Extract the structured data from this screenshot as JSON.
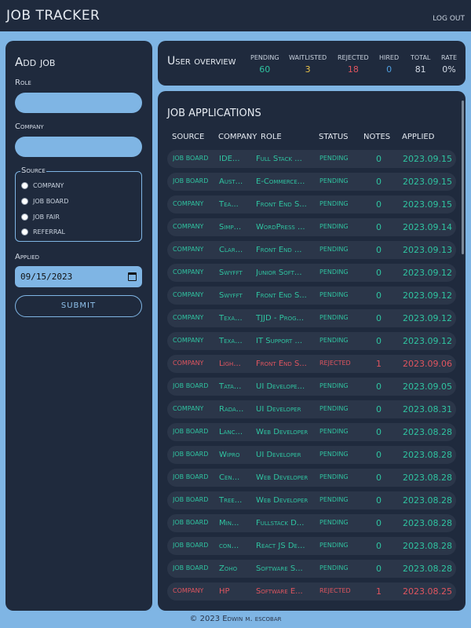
{
  "app": {
    "title": "JOB TRACKER",
    "logout_label": "LOG OUT"
  },
  "add_job": {
    "title": "Add job",
    "role_label": "Role",
    "role_value": "",
    "company_label": "Company",
    "company_value": "",
    "source_legend": "Source",
    "source_options": [
      "company",
      "job board",
      "job fair",
      "referral"
    ],
    "applied_label": "Applied",
    "applied_value": "09/15/2023",
    "submit_label": "SUBMIT"
  },
  "overview": {
    "title": "User overview",
    "stats": [
      {
        "label": "Pending",
        "value": "60",
        "color": "#2fc3a0"
      },
      {
        "label": "Waitlisted",
        "value": "3",
        "color": "#e7c24a"
      },
      {
        "label": "Rejected",
        "value": "18",
        "color": "#e0555f"
      },
      {
        "label": "Hired",
        "value": "0",
        "color": "#4f9fe0"
      },
      {
        "label": "Total",
        "value": "81",
        "color": "#d4dbe6"
      },
      {
        "label": "Rate",
        "value": "0%",
        "color": "#d4dbe6"
      }
    ]
  },
  "applications": {
    "title": "Job applications",
    "columns": [
      "Source",
      "Company",
      "Role",
      "Status",
      "Notes",
      "Applied"
    ],
    "rows": [
      {
        "source": "job board",
        "company": "IDE...",
        "role": "Full Stack ...",
        "status": "pending",
        "notes": "0",
        "applied": "2023.09.15"
      },
      {
        "source": "job board",
        "company": "Aust...",
        "role": "E-Commerce...",
        "status": "pending",
        "notes": "0",
        "applied": "2023.09.15"
      },
      {
        "source": "company",
        "company": "Tea...",
        "role": "Front End S...",
        "status": "pending",
        "notes": "0",
        "applied": "2023.09.15"
      },
      {
        "source": "company",
        "company": "Simp...",
        "role": "WordPress ...",
        "status": "pending",
        "notes": "0",
        "applied": "2023.09.14"
      },
      {
        "source": "company",
        "company": "Clar...",
        "role": "Front End ...",
        "status": "pending",
        "notes": "0",
        "applied": "2023.09.13"
      },
      {
        "source": "company",
        "company": "Swyfft",
        "role": "Junior Soft...",
        "status": "pending",
        "notes": "0",
        "applied": "2023.09.12"
      },
      {
        "source": "company",
        "company": "Swyfft",
        "role": "Front End S...",
        "status": "pending",
        "notes": "0",
        "applied": "2023.09.12"
      },
      {
        "source": "company",
        "company": "Texa...",
        "role": "TJJD - Prog...",
        "status": "pending",
        "notes": "0",
        "applied": "2023.09.12"
      },
      {
        "source": "company",
        "company": "Texa...",
        "role": "IT Support ...",
        "status": "pending",
        "notes": "0",
        "applied": "2023.09.12"
      },
      {
        "source": "company",
        "company": "Ligh...",
        "role": "Front End S...",
        "status": "rejected",
        "notes": "1",
        "applied": "2023.09.06"
      },
      {
        "source": "job board",
        "company": "Tata...",
        "role": "UI Develope...",
        "status": "pending",
        "notes": "0",
        "applied": "2023.09.05"
      },
      {
        "source": "company",
        "company": "Rada...",
        "role": "UI Developer",
        "status": "pending",
        "notes": "0",
        "applied": "2023.08.31"
      },
      {
        "source": "job board",
        "company": "Lanc...",
        "role": "Web Developer",
        "status": "pending",
        "notes": "0",
        "applied": "2023.08.28"
      },
      {
        "source": "job board",
        "company": "Wipro",
        "role": "UI Developer",
        "status": "pending",
        "notes": "0",
        "applied": "2023.08.28"
      },
      {
        "source": "job board",
        "company": "Cen...",
        "role": "Web Developer",
        "status": "pending",
        "notes": "0",
        "applied": "2023.08.28"
      },
      {
        "source": "job board",
        "company": "Tree...",
        "role": "Web Developer",
        "status": "pending",
        "notes": "0",
        "applied": "2023.08.28"
      },
      {
        "source": "job board",
        "company": "Min...",
        "role": "Fullstack D...",
        "status": "pending",
        "notes": "0",
        "applied": "2023.08.28"
      },
      {
        "source": "job board",
        "company": "con...",
        "role": "React JS De...",
        "status": "pending",
        "notes": "0",
        "applied": "2023.08.28"
      },
      {
        "source": "job board",
        "company": "Zoho",
        "role": "Software S...",
        "status": "pending",
        "notes": "0",
        "applied": "2023.08.28"
      },
      {
        "source": "company",
        "company": "HP",
        "role": "Software E...",
        "status": "rejected",
        "notes": "1",
        "applied": "2023.08.25"
      }
    ]
  },
  "footer": {
    "text": "© 2023 Edwin m. escobar"
  }
}
